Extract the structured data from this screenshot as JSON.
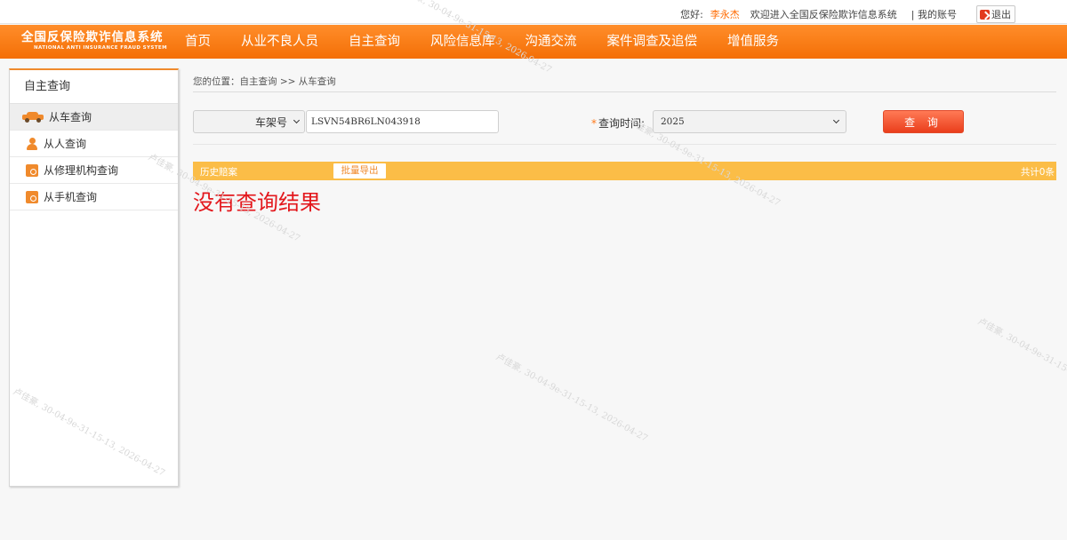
{
  "topbar": {
    "greeting": "您好:",
    "username": "李永杰",
    "welcome": "欢迎进入全国反保险欺诈信息系统",
    "account": "| 我的账号",
    "logout": "退出"
  },
  "brand": {
    "cn": "全国反保险欺诈信息系统",
    "en": "NATIONAL ANTI INSURANCE FRAUD SYSTEM"
  },
  "nav": {
    "items": [
      "首页",
      "从业不良人员",
      "自主查询",
      "风险信息库",
      "沟通交流",
      "案件调查及追偿",
      "增值服务"
    ]
  },
  "sidebar": {
    "title": "自主查询",
    "items": [
      {
        "label": "从车查询",
        "icon": "car-icon"
      },
      {
        "label": "从人查询",
        "icon": "person-icon"
      },
      {
        "label": "从修理机构查询",
        "icon": "repair-org-icon"
      },
      {
        "label": "从手机查询",
        "icon": "phone-icon"
      }
    ]
  },
  "breadcrumb": "您的位置：自主查询 >> 从车查询",
  "query": {
    "type_selected": "车架号",
    "vin_value": "LSVN54BR6LN043918",
    "time_label": "查询时间:",
    "year_selected": "2025",
    "search_label": "查 询"
  },
  "result": {
    "tab_label": "历史赔案",
    "export_label": "批量导出",
    "total": "共计0条",
    "empty_message": "没有查询结果"
  },
  "watermark": {
    "text": "卢佳豪, 30-04-9e-31-15-13, 2026-04-27"
  },
  "colors": {
    "nav_orange": "#f47a12",
    "result_bar": "#fbbd47",
    "search_button": "#ea3e1c",
    "empty_message": "#e3171c"
  }
}
